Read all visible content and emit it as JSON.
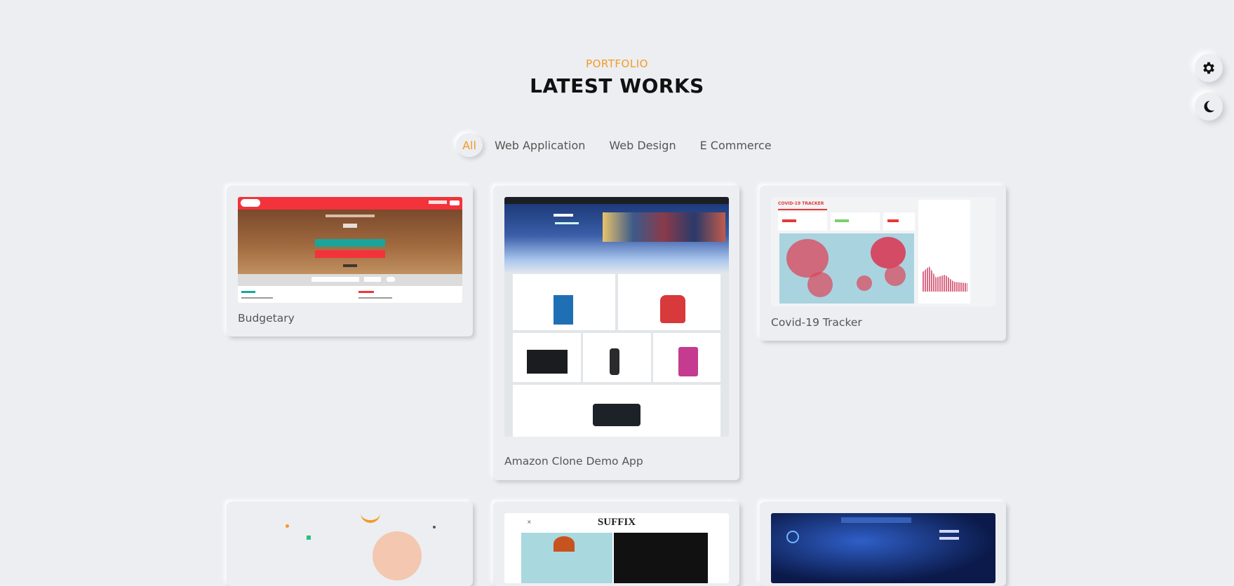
{
  "section": {
    "subtitle": "PORTFOLIO",
    "title": "LATEST WORKS"
  },
  "filters": [
    {
      "label": "All",
      "active": true
    },
    {
      "label": "Web Application",
      "active": false
    },
    {
      "label": "Web Design",
      "active": false
    },
    {
      "label": "E Commerce",
      "active": false
    }
  ],
  "side_buttons": {
    "settings_icon": "gear-icon",
    "theme_icon": "moon-icon"
  },
  "projects": [
    {
      "title": "Budgetary",
      "thumb": "budget-app-screenshot"
    },
    {
      "title": "Amazon Clone Demo App",
      "thumb": "amazon-clone-screenshot"
    },
    {
      "title": "Covid-19 Tracker",
      "thumb": "covid-tracker-screenshot",
      "thumb_heading": "COVID-19 TRACKER"
    },
    {
      "title": "",
      "thumb": "illustration-screenshot"
    },
    {
      "title": "",
      "thumb": "suffix-site-screenshot",
      "thumb_heading": "SUFFIX"
    },
    {
      "title": "",
      "thumb": "game-show-screenshot"
    }
  ],
  "colors": {
    "accent": "#f29b26",
    "background": "#eceef1",
    "budget_red": "#f2333b",
    "covid_red": "#e53935"
  }
}
